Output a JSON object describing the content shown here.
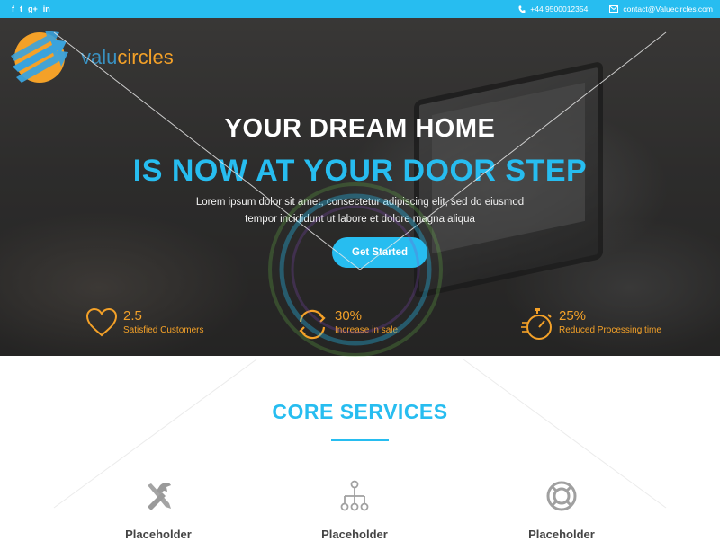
{
  "topbar": {
    "social": [
      "f",
      "t",
      "g+",
      "in"
    ],
    "phone": "+44 9500012354",
    "email": "contact@Valuecircles.com"
  },
  "brand": {
    "logo_part1": "valu",
    "logo_part2": "circles"
  },
  "hero": {
    "line1": "YOUR DREAM HOME",
    "line2": "IS NOW AT YOUR DOOR STEP",
    "description": "Lorem ipsum dolor sit amet, consectetur adipiscing elit, sed do eiusmod tempor incididunt ut labore et dolore magna aliqua",
    "cta": "Get Started"
  },
  "stats": [
    {
      "value": "2.5",
      "label": "Satisfied Customers",
      "icon": "heart-icon"
    },
    {
      "value": "30%",
      "label": "Increase in sale",
      "icon": "refresh-icon"
    },
    {
      "value": "25%",
      "label": "Reduced Processing time",
      "icon": "stopwatch-icon"
    }
  ],
  "services": {
    "title": "CORE SERVICES",
    "items": [
      {
        "name": "Placeholder",
        "icon": "tools-icon"
      },
      {
        "name": "Placeholder",
        "icon": "network-icon"
      },
      {
        "name": "Placeholder",
        "icon": "lifebuoy-icon"
      }
    ]
  },
  "colors": {
    "accent": "#27bdf0",
    "orange": "#f4a128",
    "text_dark": "#444444"
  }
}
